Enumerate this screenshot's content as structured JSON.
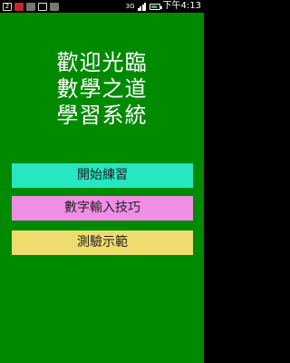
{
  "status_bar": {
    "notification_badge": "2",
    "network": "3G",
    "time": "下午4:13",
    "battery_percent": 80,
    "signal_bars": 4
  },
  "title": {
    "line1": "歡迎光臨",
    "line2": "數學之道",
    "line3": "學習系統"
  },
  "menu": {
    "start_practice_label": "開始練習",
    "digit_input_tips_label": "數字輸入技巧",
    "demo_label": "測驗示範"
  },
  "colors": {
    "background": "#008a00",
    "button1": "#27e6c2",
    "button2": "#f08ee6",
    "button3": "#f0dc6e"
  }
}
